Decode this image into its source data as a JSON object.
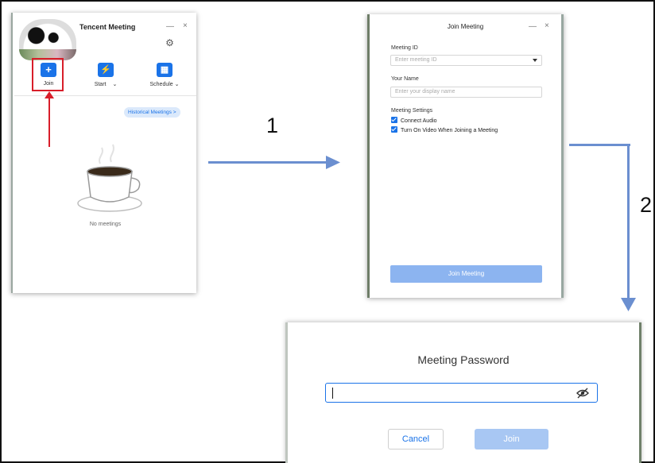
{
  "colors": {
    "accent": "#1a73e8",
    "highlight": "#d81e2a",
    "flow_arrow": "#6b8fd0",
    "join_button_disabled": "#8cb4f0"
  },
  "main_window": {
    "title": "Tencent Meeting",
    "minimize": "—",
    "close": "×",
    "settings_icon": "gear-icon",
    "tools": [
      {
        "label": "Join",
        "icon": "plus-icon",
        "glyph": "+"
      },
      {
        "label": "Start",
        "icon": "lightning-icon",
        "glyph": "⚡"
      },
      {
        "label": "Schedule",
        "icon": "calendar-icon",
        "glyph": "▦"
      }
    ],
    "historical_button": "Historical Meetings >",
    "empty_text": "No meetings"
  },
  "join_dialog": {
    "title": "Join Meeting",
    "minimize": "—",
    "close": "×",
    "meeting_id_label": "Meeting ID",
    "meeting_id_placeholder": "Enter meeting ID",
    "name_label": "Your Name",
    "name_placeholder": "Enter your display name",
    "settings_label": "Meeting Settings",
    "options": [
      {
        "label": "Connect Audio",
        "checked": true
      },
      {
        "label": "Turn On Video When Joining a Meeting",
        "checked": true
      }
    ],
    "join_button": "Join Meeting"
  },
  "password_dialog": {
    "title": "Meeting Password",
    "input_value": "",
    "eye_icon": "eye-slash-icon",
    "cancel_button": "Cancel",
    "join_button": "Join"
  },
  "steps": {
    "step1": "1",
    "step2": "2"
  }
}
